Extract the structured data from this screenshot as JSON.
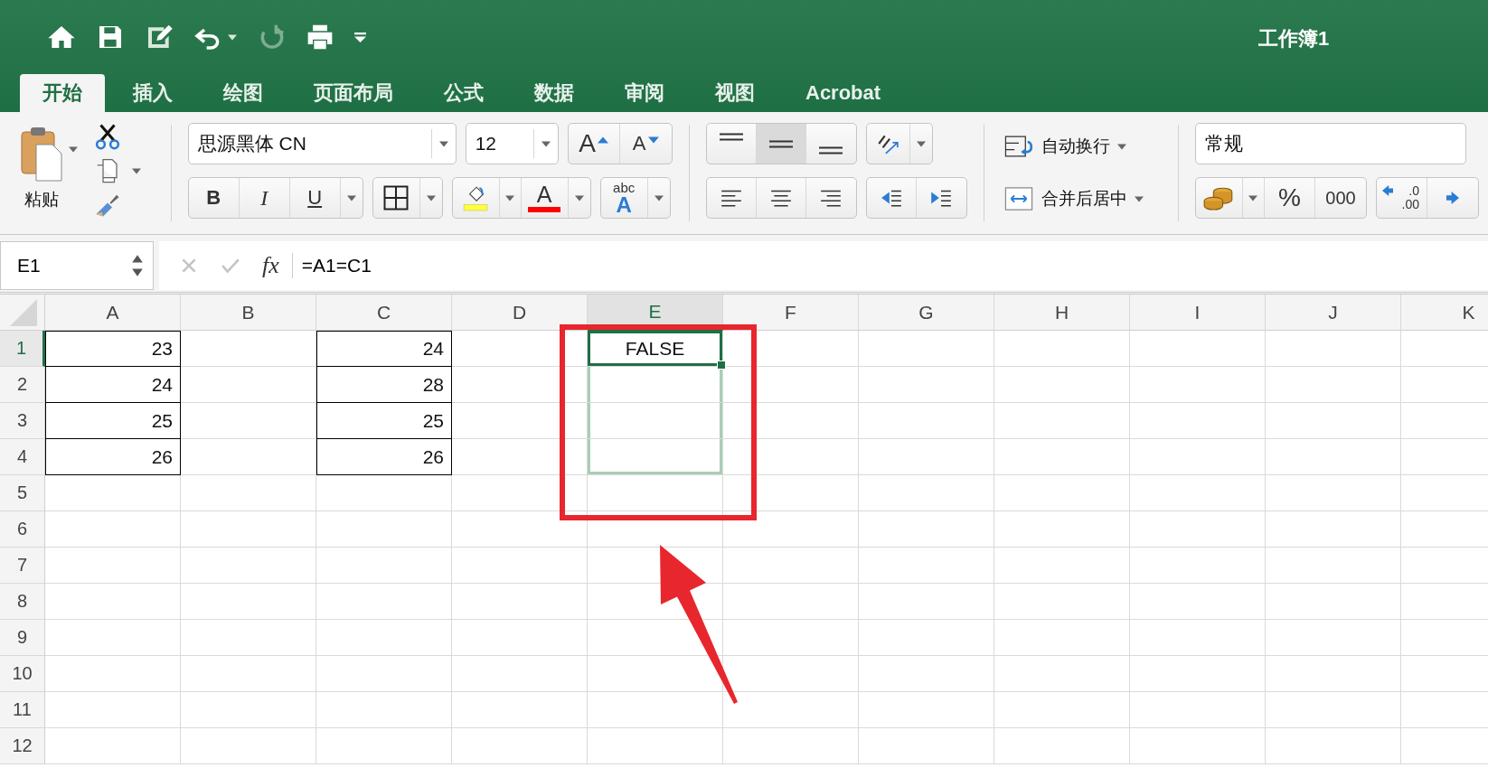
{
  "window": {
    "title": "工作簿1"
  },
  "quick_access": {
    "redo_enabled": false
  },
  "tabs": [
    {
      "label": "开始",
      "selected": true
    },
    {
      "label": "插入",
      "selected": false
    },
    {
      "label": "绘图",
      "selected": false
    },
    {
      "label": "页面布局",
      "selected": false
    },
    {
      "label": "公式",
      "selected": false
    },
    {
      "label": "数据",
      "selected": false
    },
    {
      "label": "审阅",
      "selected": false
    },
    {
      "label": "视图",
      "selected": false
    },
    {
      "label": "Acrobat",
      "selected": false
    }
  ],
  "ribbon": {
    "paste_label": "粘贴",
    "font_name": "思源黑体 CN",
    "font_size": "12",
    "grow_glyph": "A",
    "shrink_glyph": "A",
    "style_buttons": [
      "B",
      "I",
      "U"
    ],
    "font_color_glyph": "A",
    "phonetic_glyphs": [
      "abc",
      "A"
    ],
    "vertical_align": [
      {
        "selected": false
      },
      {
        "selected": true
      },
      {
        "selected": false
      }
    ],
    "wrap_text": "自动换行",
    "merge_center": "合并后居中",
    "number_format": "常规",
    "number_buttons": [
      "%",
      "000"
    ],
    "decimal_glyphs": [
      ".0",
      ".00"
    ]
  },
  "formula_bar": {
    "name_box": "E1",
    "fx": "fx",
    "formula": "=A1=C1"
  },
  "sheet": {
    "columns": [
      {
        "label": "A",
        "selected": false
      },
      {
        "label": "B",
        "selected": false
      },
      {
        "label": "C",
        "selected": false
      },
      {
        "label": "D",
        "selected": false
      },
      {
        "label": "E",
        "selected": true
      },
      {
        "label": "F",
        "selected": false
      },
      {
        "label": "G",
        "selected": false
      },
      {
        "label": "H",
        "selected": false
      },
      {
        "label": "I",
        "selected": false
      },
      {
        "label": "J",
        "selected": false
      },
      {
        "label": "K",
        "selected": false
      }
    ],
    "rows": [
      {
        "header": "1",
        "selected": true,
        "cells": [
          {
            "value": "23",
            "bordered": true,
            "active": false,
            "in_range": false
          },
          {
            "bordered": false,
            "active": false,
            "in_range": false
          },
          {
            "value": "24",
            "bordered": true,
            "active": false,
            "in_range": false
          },
          {
            "bordered": false,
            "active": false,
            "in_range": false
          },
          {
            "value": "FALSE",
            "bordered": false,
            "active": true,
            "in_range": true
          }
        ]
      },
      {
        "header": "2",
        "selected": false,
        "cells": [
          {
            "value": "24",
            "bordered": true,
            "active": false,
            "in_range": false
          },
          {
            "bordered": false,
            "active": false,
            "in_range": false
          },
          {
            "value": "28",
            "bordered": true,
            "active": false,
            "in_range": false
          },
          {
            "bordered": false,
            "active": false,
            "in_range": false
          },
          {
            "bordered": false,
            "active": false,
            "in_range": true
          }
        ]
      },
      {
        "header": "3",
        "selected": false,
        "cells": [
          {
            "value": "25",
            "bordered": true,
            "active": false,
            "in_range": false
          },
          {
            "bordered": false,
            "active": false,
            "in_range": false
          },
          {
            "value": "25",
            "bordered": true,
            "active": false,
            "in_range": false
          },
          {
            "bordered": false,
            "active": false,
            "in_range": false
          },
          {
            "bordered": false,
            "active": false,
            "in_range": true
          }
        ]
      },
      {
        "header": "4",
        "selected": false,
        "cells": [
          {
            "value": "26",
            "bordered": true,
            "active": false,
            "in_range": false
          },
          {
            "bordered": false,
            "active": false,
            "in_range": false
          },
          {
            "value": "26",
            "bordered": true,
            "active": false,
            "in_range": false
          },
          {
            "bordered": false,
            "active": false,
            "in_range": false
          },
          {
            "bordered": false,
            "active": false,
            "in_range": true
          }
        ]
      },
      {
        "header": "5",
        "selected": false
      },
      {
        "header": "6",
        "selected": false
      },
      {
        "header": "7",
        "selected": false
      },
      {
        "header": "8",
        "selected": false
      },
      {
        "header": "9",
        "selected": false
      },
      {
        "header": "10",
        "selected": false
      },
      {
        "header": "11",
        "selected": false
      },
      {
        "header": "12",
        "selected": false
      }
    ]
  }
}
